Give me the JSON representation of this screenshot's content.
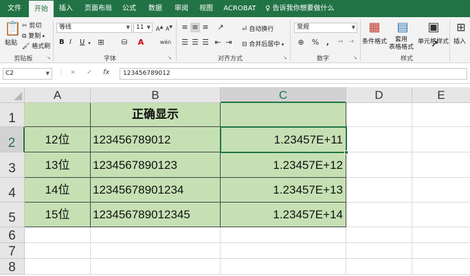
{
  "tabs": [
    "文件",
    "开始",
    "插入",
    "页面布局",
    "公式",
    "数据",
    "审阅",
    "视图",
    "ACROBAT"
  ],
  "active_tab": "开始",
  "tell_me": "告诉我你想要做什么",
  "ribbon": {
    "clipboard": {
      "paste": "粘贴",
      "cut": "剪切",
      "copy": "复制",
      "format_painter": "格式刷",
      "label": "剪贴板"
    },
    "font": {
      "font_name": "等线",
      "font_size": "11",
      "bold": "B",
      "italic": "I",
      "underline": "U",
      "label": "字体",
      "phonetic": "wén"
    },
    "alignment": {
      "wrap_text": "自动换行",
      "merge_center": "合并后居中",
      "label": "对齐方式"
    },
    "number": {
      "format": "常规",
      "percent": "%",
      "comma": ",",
      "label": "数字"
    },
    "styles": {
      "conditional": "条件格式",
      "table": "套用\n表格格式",
      "cell_styles": "单元格样式",
      "label": "样式"
    },
    "cells": {
      "insert": "插入"
    }
  },
  "formula_bar": {
    "name_box": "C2",
    "cancel": "×",
    "enter": "✓",
    "fx": "fx",
    "value": "123456789012"
  },
  "columns": [
    "A",
    "B",
    "C",
    "D",
    "E"
  ],
  "rows": [
    "1",
    "2",
    "3",
    "4",
    "5",
    "6",
    "7",
    "8"
  ],
  "cells": {
    "B1": "正确显示",
    "A2": "12位",
    "B2": "123456789012",
    "C2": "1.23457E+11",
    "A3": "13位",
    "B3": "1234567890123",
    "C3": "1.23457E+12",
    "A4": "14位",
    "B4": "12345678901234",
    "C4": "1.23457E+13",
    "A5": "15位",
    "B5": "123456789012345",
    "C5": "1.23457E+14"
  },
  "colors": {
    "excel_green": "#217346",
    "cell_fill": "#c6e0b4"
  }
}
